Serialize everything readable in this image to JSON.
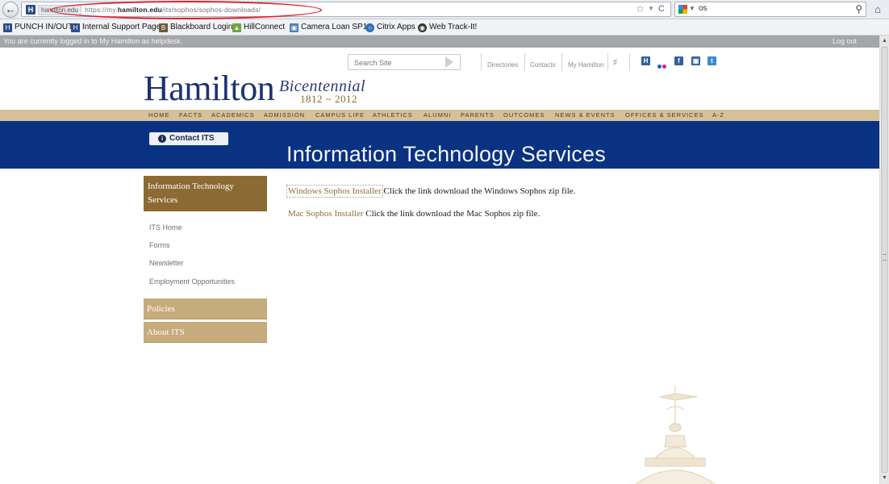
{
  "browser": {
    "url_prefix": "https://my.",
    "url_domain": "hamilton.edu",
    "url_path": "/its/sophos/sophos-downloads/",
    "site_identity": "hamilton.edu",
    "search_query": "os"
  },
  "bookmarks": [
    {
      "label": "PUNCH IN/OUT",
      "icon": "hamilton-h-icon"
    },
    {
      "label": "Internal Support Page",
      "icon": "hamilton-h-icon"
    },
    {
      "label": "Blackboard Login",
      "icon": "blackboard-icon"
    },
    {
      "label": "HillConnect",
      "icon": "hillconnect-icon"
    },
    {
      "label": "Camera Loan SP12",
      "icon": "camera-icon"
    },
    {
      "label": "Citrix Apps",
      "icon": "citrix-icon"
    },
    {
      "label": "Web Track-It!",
      "icon": "trackit-icon"
    }
  ],
  "login_bar": {
    "status": "You are currently logged in to My Hamilton as helpdesk.",
    "logout": "Log out"
  },
  "utility": {
    "search_placeholder": "Search Site",
    "links": [
      "Directories",
      "Contacts",
      "My Hamilton"
    ]
  },
  "logo": {
    "name": "Hamilton",
    "bicentennial": "Bicentennial",
    "years": "1812 ~ 2012"
  },
  "main_nav": [
    "HOME",
    "FACTS",
    "ACADEMICS",
    "ADMISSION",
    "CAMPUS LIFE",
    "ATHLETICS",
    "ALUMNI",
    "PARENTS",
    "OUTCOMES",
    "NEWS & EVENTS",
    "OFFICES & SERVICES",
    "A-Z"
  ],
  "banner": {
    "contact_button": "Contact ITS",
    "title": "Information Technology Services"
  },
  "sidebar": {
    "header_line1": "Information Technology",
    "header_line2": "Services",
    "links": [
      "ITS Home",
      "Forms",
      "Newsletter",
      "Employment Opportunities"
    ],
    "sections": [
      "Policies",
      "About ITS"
    ]
  },
  "content": [
    {
      "link": "Windows Sophos Installer",
      "text": " Click the link download the Windows Sophos zip file."
    },
    {
      "link": "Mac Sophos Installer",
      "text": " Click the link download the Mac Sophos zip file."
    }
  ],
  "colors": {
    "brand_blue": "#0a3283",
    "brand_gold": "#8c6a33",
    "nav_tan": "#d6c19a",
    "annotation_red": "#e0202b"
  }
}
